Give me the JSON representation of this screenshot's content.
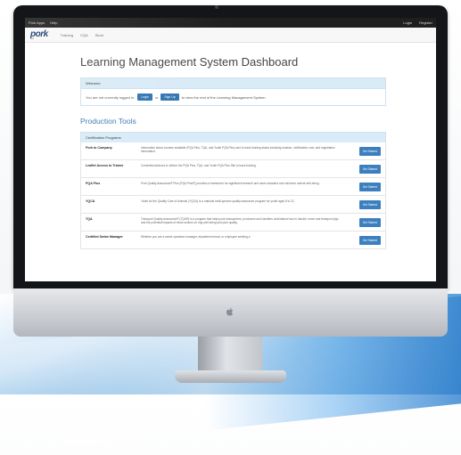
{
  "topbar": {
    "left": [
      "Pork Apps",
      "Help"
    ],
    "right": [
      "Login",
      "Register"
    ]
  },
  "navbar": {
    "logo": "pork",
    "logo_tag": "checkoff",
    "links": [
      "Training",
      "CQA",
      "Store"
    ]
  },
  "page": {
    "title": "Learning Management System Dashboard"
  },
  "welcome": {
    "heading": "Welcome",
    "text_before": "You are not currently logged in.",
    "login_button": "Login",
    "middle": "or",
    "signup_button": "Sign Up",
    "text_after": "to view the rest of the Learning Management System."
  },
  "production": {
    "title": "Production Tools",
    "header": "Certification Programs",
    "programs": [
      {
        "name": "Pork to Company",
        "desc": "Information about courses available (PQA Plus, TQA, and Youth PQA Plus) and to track training status including location, certification cost, and registration information.",
        "button": "Get Started"
      },
      {
        "name": "Leaflet Access to Trainer",
        "desc": "Credential advisors to deliver the PQA Plus, TQA, and Youth PQA Plus Site to track training.",
        "button": "Get Started"
      },
      {
        "name": "PQA Plus",
        "desc": "Pork Quality Assurance® Plus (PQA Plus®) provides a framework for significant research and cares standard and minimum animal well-being.",
        "button": "Get Started"
      },
      {
        "name": "YQCA",
        "desc": "Youth for the Quality Care of Animals (YQCA) is a national multi-species quality assurance program for youth ages 8 to 21.",
        "button": "Get Started"
      },
      {
        "name": "TQA",
        "desc": "Transport Quality Assurance® (TQA®) is a program that helps pork transporters, producers and handlers understand how to handle, move and transport pigs and the potential impacts of those actions on hog well-being and pork quality.",
        "button": "Get Started"
      },
      {
        "name": "Certified Swine Manager",
        "desc": "Whether you are a swine operation manager, department head, or employee seeking a",
        "button": "Get Started"
      }
    ]
  },
  "colors": {
    "accent": "#3b7fbf",
    "panel_header": "#d9ebf7",
    "topbar": "#1f1f1f",
    "bezel": "#141518"
  }
}
